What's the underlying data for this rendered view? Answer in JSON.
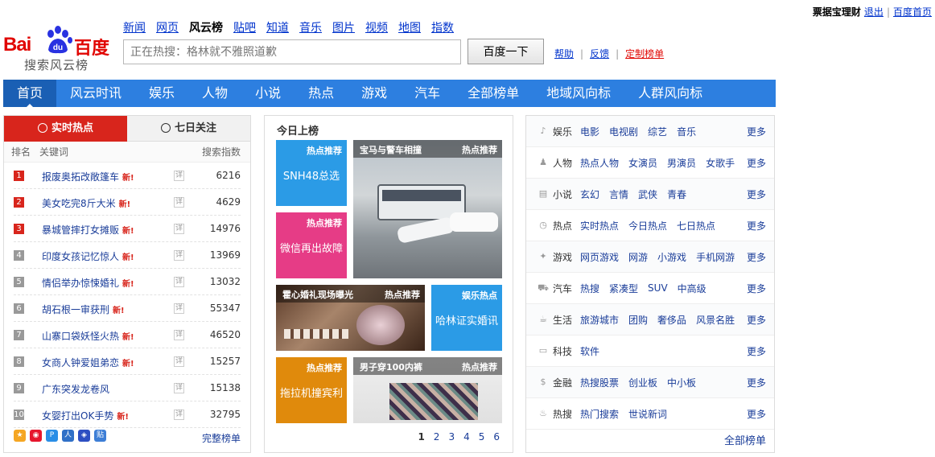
{
  "user_bar": {
    "username": "票据宝理财",
    "logout": "退出",
    "home": "百度首页"
  },
  "logo": {
    "bai": "Bai",
    "du": "du",
    "cn": "百度",
    "sub": "搜索风云榜"
  },
  "top_nav": [
    {
      "label": "新闻",
      "current": false
    },
    {
      "label": "网页",
      "current": false
    },
    {
      "label": "风云榜",
      "current": true
    },
    {
      "label": "贴吧",
      "current": false
    },
    {
      "label": "知道",
      "current": false
    },
    {
      "label": "音乐",
      "current": false
    },
    {
      "label": "图片",
      "current": false
    },
    {
      "label": "视频",
      "current": false
    },
    {
      "label": "地图",
      "current": false
    },
    {
      "label": "指数",
      "current": false
    }
  ],
  "search": {
    "placeholder": "正在热搜：格林就不雅照道歉",
    "button": "百度一下"
  },
  "aux_links": {
    "help": "帮助",
    "feedback": "反馈",
    "custom": "定制榜单"
  },
  "main_nav": [
    "首页",
    "风云时讯",
    "娱乐",
    "人物",
    "小说",
    "热点",
    "游戏",
    "汽车",
    "全部榜单",
    "地域风向标",
    "人群风向标"
  ],
  "left": {
    "tab_realtime": "实时热点",
    "tab_7days": "七日关注",
    "col_rank": "排名",
    "col_keyword": "关键词",
    "col_index": "搜索指数",
    "detail_label": "详",
    "new_label": "新!",
    "rows": [
      {
        "rank": "1",
        "keyword": "报废奥拓改敞篷车",
        "index": "6216",
        "new": true
      },
      {
        "rank": "2",
        "keyword": "美女吃完8斤大米",
        "index": "4629",
        "new": true
      },
      {
        "rank": "3",
        "keyword": "暴城管摔打女摊贩",
        "index": "14976",
        "new": true
      },
      {
        "rank": "4",
        "keyword": "印度女孩记忆惊人",
        "index": "13969",
        "new": true
      },
      {
        "rank": "5",
        "keyword": "情侣举办惊悚婚礼",
        "index": "13032",
        "new": true
      },
      {
        "rank": "6",
        "keyword": "胡石根一审获刑",
        "index": "55347",
        "new": true
      },
      {
        "rank": "7",
        "keyword": "山寨口袋妖怪火热",
        "index": "46520",
        "new": true
      },
      {
        "rank": "8",
        "keyword": "女商人钟爱姐弟恋",
        "index": "15257",
        "new": true
      },
      {
        "rank": "9",
        "keyword": "广东突发龙卷风",
        "index": "15138",
        "new": false
      },
      {
        "rank": "10",
        "keyword": "女婴打出OK手势",
        "index": "32795",
        "new": true
      }
    ],
    "full_list": "完整榜单"
  },
  "middle": {
    "title": "今日上榜",
    "tiles": {
      "t1": {
        "tag": "热点推荐",
        "caption": "SNH48总选",
        "color": "#2b9be6"
      },
      "t2": {
        "tag": "热点推荐",
        "caption": "微信再出故障",
        "color": "#e63c86"
      },
      "t3": {
        "tag": "热点推荐",
        "title": "宝马与警车相撞"
      },
      "t4": {
        "tag": "热点推荐",
        "title": "霍心婚礼现场曝光"
      },
      "t5": {
        "tag": "娱乐热点",
        "caption": "哈林证实婚讯",
        "color": "#2b9be6"
      },
      "t6": {
        "tag": "热点推荐",
        "caption": "拖拉机撞宾利",
        "color": "#e08a0c"
      },
      "t7": {
        "tag": "热点推荐",
        "title": "男子穿100内裤"
      }
    },
    "pages": [
      "1",
      "2",
      "3",
      "4",
      "5",
      "6"
    ]
  },
  "right": {
    "more_label": "更多",
    "categories": [
      {
        "icon": "♪",
        "name": "娱乐",
        "subs": [
          "电影",
          "电视剧",
          "综艺",
          "音乐"
        ]
      },
      {
        "icon": "♟",
        "name": "人物",
        "subs": [
          "热点人物",
          "女演员",
          "男演员",
          "女歌手"
        ]
      },
      {
        "icon": "▤",
        "name": "小说",
        "subs": [
          "玄幻",
          "言情",
          "武侠",
          "青春"
        ]
      },
      {
        "icon": "◷",
        "name": "热点",
        "subs": [
          "实时热点",
          "今日热点",
          "七日热点"
        ]
      },
      {
        "icon": "✦",
        "name": "游戏",
        "subs": [
          "网页游戏",
          "网游",
          "小游戏",
          "手机网游"
        ]
      },
      {
        "icon": "⛟",
        "name": "汽车",
        "subs": [
          "热搜",
          "紧凑型",
          "SUV",
          "中高级"
        ]
      },
      {
        "icon": "☕",
        "name": "生活",
        "subs": [
          "旅游城市",
          "团购",
          "奢侈品",
          "风景名胜"
        ]
      },
      {
        "icon": "▭",
        "name": "科技",
        "subs": [
          "软件"
        ]
      },
      {
        "icon": "$",
        "name": "金融",
        "subs": [
          "热搜股票",
          "创业板",
          "中小板"
        ]
      },
      {
        "icon": "♨",
        "name": "热搜",
        "subs": [
          "热门搜索",
          "世说新词"
        ]
      }
    ],
    "all_lists": "全部榜单"
  }
}
